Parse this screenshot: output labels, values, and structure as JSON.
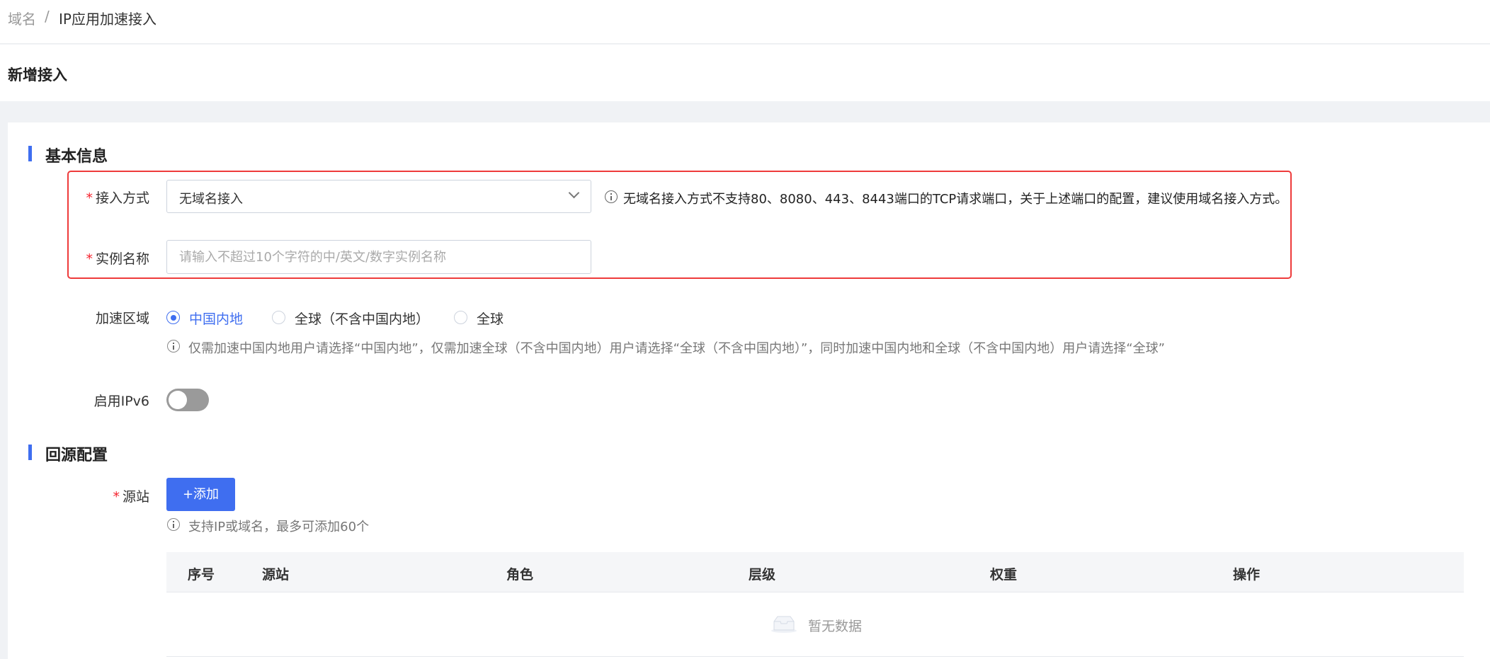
{
  "breadcrumb": {
    "root": "域名",
    "separator": "/",
    "current": "IP应用加速接入"
  },
  "page": {
    "title": "新增接入"
  },
  "basic_info": {
    "section_title": "基本信息",
    "access_method": {
      "label": "接入方式",
      "value": "无域名接入",
      "hint": "无域名接入方式不支持80、8080、443、8443端口的TCP请求端口，关于上述端口的配置，建议使用域名接入方式。"
    },
    "instance_name": {
      "label": "实例名称",
      "placeholder": "请输入不超过10个字符的中/英文/数字实例名称",
      "value": ""
    },
    "accel_region": {
      "label": "加速区域",
      "options": [
        "中国内地",
        "全球（不含中国内地）",
        "全球"
      ],
      "selected": "中国内地",
      "hint": "仅需加速中国内地用户请选择“中国内地”，仅需加速全球（不含中国内地）用户请选择“全球（不含中国内地）”，同时加速中国内地和全球（不含中国内地）用户请选择“全球”"
    },
    "ipv6": {
      "label": "启用IPv6",
      "enabled": false
    }
  },
  "origin_config": {
    "section_title": "回源配置",
    "source": {
      "label": "源站",
      "add_button": "+添加",
      "hint": "支持IP或域名，最多可添加60个"
    },
    "table": {
      "columns": [
        "序号",
        "源站",
        "角色",
        "层级",
        "权重",
        "操作"
      ],
      "rows": [],
      "empty_text": "暂无数据"
    }
  },
  "colors": {
    "accent": "#3f6ef0",
    "required": "#f5222d",
    "highlight_border": "#ee3b3b"
  }
}
